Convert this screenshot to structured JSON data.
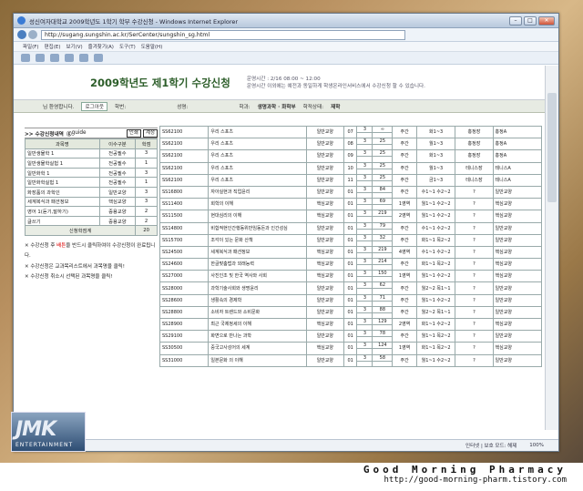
{
  "window": {
    "title": "성신여자대학교 2009학년도 1학기 학부 수강신청 - Windows Internet Explorer",
    "url": "http://sugang.sungshin.ac.kr/SerCenter/sungshin_sg.html"
  },
  "menu": [
    "파일(F)",
    "편집(E)",
    "보기(V)",
    "즐겨찾기(A)",
    "도구(T)",
    "도움말(H)"
  ],
  "header": {
    "title": "2009학년도 제1학기 수강신청",
    "info1": "운영시간 : 2/16 08:00 ~ 12:00",
    "info2": "운영시간 이외에는 예전과 동일하게 학생온라인서비스에서 수강신청 할 수 있습니다."
  },
  "userbar": {
    "greet": "님 환영합니다.",
    "logout": "로그아웃",
    "id_label": "학번:",
    "name_label": "성명:",
    "dept_label": "학과:",
    "dept": "생명과학 · 화학부",
    "status_label": "학적상태:",
    "status": "재학"
  },
  "left": {
    "title": ">> 수강신청내역",
    "guide": "guide",
    "buttons": [
      "인쇄",
      "계정"
    ],
    "columns": [
      "과목명",
      "이수구분",
      "학점"
    ],
    "rows": [
      [
        "일반생물학 1",
        "전공필수",
        "3"
      ],
      [
        "일반생물학실험 1",
        "전공필수",
        "1"
      ],
      [
        "일반화학 1",
        "전공필수",
        "3"
      ],
      [
        "일반화학실험 1",
        "전공필수",
        "1"
      ],
      [
        "화장품의 과학인",
        "일반교양",
        "3"
      ],
      [
        "세계복식과 패션정보",
        "핵심교양",
        "3"
      ],
      [
        "영어 1(듣기,말하기)",
        "중용교양",
        "2"
      ],
      [
        "글쓰기",
        "중용교양",
        "2"
      ]
    ],
    "total_label": "신청학점계",
    "total": "20",
    "notes": [
      {
        "pre": "수강신청 후 ",
        "red": "배튼",
        "post": "을 반드시 클릭하여야 수강신청이 완료됩니다."
      },
      {
        "pre": "수강신청은 교과목리스트에서 과목명을 클릭!",
        "red": "",
        "post": ""
      },
      {
        "pre": "수강신청 취소시 선택된 과목명을 클릭!",
        "red": "",
        "post": ""
      }
    ]
  },
  "courses": [
    [
      "SS62100",
      "우리 스포츠",
      "일반교양",
      "07",
      "3",
      "∞",
      "주간",
      "화1~3",
      "홍정장",
      "홍정A"
    ],
    [
      "SS62100",
      "우리 스포츠",
      "일반교양",
      "08",
      "3",
      "25",
      "주간",
      "월1~3",
      "홍정장",
      "홍정A"
    ],
    [
      "SS62100",
      "우리 스포츠",
      "일반교양",
      "09",
      "3",
      "25",
      "주간",
      "화1~3",
      "홍정장",
      "홍정A"
    ],
    [
      "SS62100",
      "우리 스포츠",
      "일반교양",
      "10",
      "3",
      "25",
      "주간",
      "월1~3",
      "테니스장",
      "테니스A"
    ],
    [
      "SS62100",
      "우리 스포츠",
      "일반교양",
      "11",
      "3",
      "25",
      "주간",
      "금1~3",
      "테니스장",
      "테니스A"
    ],
    [
      "SS16800",
      "자아실현과 직업윤리",
      "일반교양",
      "01",
      "3",
      "84",
      "주간",
      "수1~1 수2~2",
      "?",
      "일반교양"
    ],
    [
      "SS11400",
      "회학의 이해",
      "핵심교양",
      "01",
      "3",
      "69",
      "1영역",
      "월1~1 수2~2",
      "?",
      "핵심교양"
    ],
    [
      "SS11500",
      "현대심리의 이해",
      "핵심교양",
      "01",
      "3",
      "219",
      "2영역",
      "월1~1 수2~2",
      "?",
      "핵심교양"
    ],
    [
      "SS14800",
      "비합적현인간행동위반임동돈과 인간성심",
      "일반교양",
      "01",
      "3",
      "79",
      "주간",
      "수1~1 수2~2",
      "?",
      "일반교양"
    ],
    [
      "SS15700",
      "조각이 있는 문화 산책",
      "일반교양",
      "01",
      "3",
      "32",
      "주간",
      "화1~1 목2~2",
      "?",
      "일반교양"
    ],
    [
      "SS24500",
      "세계복식과 패션정보",
      "핵심교양",
      "01",
      "3",
      "219",
      "4영역",
      "수1~1 수2~2",
      "?",
      "핵심교양"
    ],
    [
      "SS24600",
      "한글맞춤법과 외래능력",
      "핵심교양",
      "01",
      "3",
      "214",
      "주간",
      "화1~1 목2~2",
      "?",
      "핵심교양"
    ],
    [
      "SS27000",
      "사진인조 및 한국 역사와 사회",
      "핵심교양",
      "01",
      "3",
      "150",
      "1영역",
      "월1~1 수2~2",
      "?",
      "핵심교양"
    ],
    [
      "SS28000",
      "과학기술사회와 생명윤리",
      "일반교양",
      "01",
      "3",
      "62",
      "주간",
      "월2~2 목1~1",
      "?",
      "일반교양"
    ],
    [
      "SS28600",
      "생활속의 경제학",
      "일반교양",
      "01",
      "3",
      "71",
      "주간",
      "월1~1 수2~2",
      "?",
      "일반교양"
    ],
    [
      "SS28800",
      "소비자 트렌드와 소비문화",
      "일반교양",
      "01",
      "3",
      "88",
      "주간",
      "월2~2 목1~1",
      "?",
      "일반교양"
    ],
    [
      "SS28900",
      "최근 국제정세의 이해",
      "핵심교양",
      "01",
      "3",
      "129",
      "2영역",
      "화1~1 수2~2",
      "?",
      "핵심교양"
    ],
    [
      "SS29100",
      "화면으로 만나는 과학",
      "일반교양",
      "01",
      "3",
      "78",
      "주간",
      "월1~1 목2~2",
      "?",
      "일반교양"
    ],
    [
      "SS30500",
      "중국고사성어의 세계",
      "핵심교양",
      "01",
      "3",
      "124",
      "1영역",
      "화1~1 목2~2",
      "?",
      "핵심교양"
    ],
    [
      "SS31000",
      "일본문화 의 이해",
      "일반교양",
      "01",
      "3",
      "58",
      "주간",
      "월1~1 수2~2",
      "?",
      "일반교양"
    ]
  ],
  "status": {
    "zone": "인터넷 | 보호 모드: 해제",
    "zoom": "100%"
  },
  "watermark": {
    "name": "Good Morning Pharmacy",
    "url": "http://good-morning-pharm.tistory.com"
  },
  "logo": {
    "text": "JMK",
    "sub": "ENTERTAINMENT"
  }
}
